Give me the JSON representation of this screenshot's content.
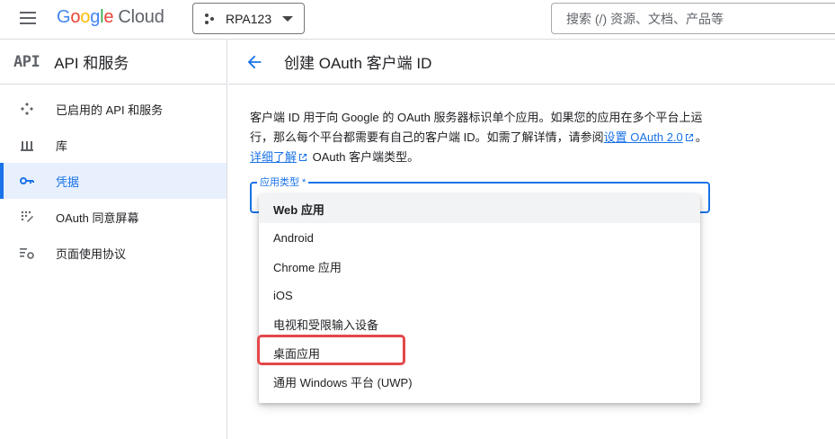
{
  "header": {
    "logo_google": [
      "G",
      "o",
      "o",
      "g",
      "l",
      "e"
    ],
    "logo_product": "Cloud",
    "project": "RPA123",
    "search_placeholder": "搜索 (/) 资源、文档、产品等"
  },
  "sidebar": {
    "badge": "API",
    "title": "API 和服务",
    "items": [
      {
        "label": "已启用的 API 和服务",
        "icon": "api-hub-icon"
      },
      {
        "label": "库",
        "icon": "library-icon"
      },
      {
        "label": "凭据",
        "icon": "key-icon",
        "active": true
      },
      {
        "label": "OAuth 同意屏幕",
        "icon": "consent-icon"
      },
      {
        "label": "页面使用协议",
        "icon": "page-settings-icon"
      }
    ]
  },
  "main": {
    "title": "创建 OAuth 客户端 ID",
    "description": {
      "part1": "客户端 ID 用于向 Google 的 OAuth 服务器标识单个应用。如果您的应用在多个平台上运行，那么每个平台都需要有自己的客户端 ID。如需了解详情，请参阅",
      "link1": "设置 OAuth 2.0",
      "part2": "。",
      "link2": "详细了解",
      "part3": " OAuth 客户端类型。"
    },
    "field_label": "应用类型 *",
    "options": [
      "Web 应用",
      "Android",
      "Chrome 应用",
      "iOS",
      "电视和受限输入设备",
      "桌面应用",
      "通用 Windows 平台 (UWP)"
    ],
    "selected_option": "Web 应用",
    "highlighted_option": "桌面应用"
  },
  "colors": {
    "accent": "#1a73e8",
    "highlight": "#e4474a"
  }
}
